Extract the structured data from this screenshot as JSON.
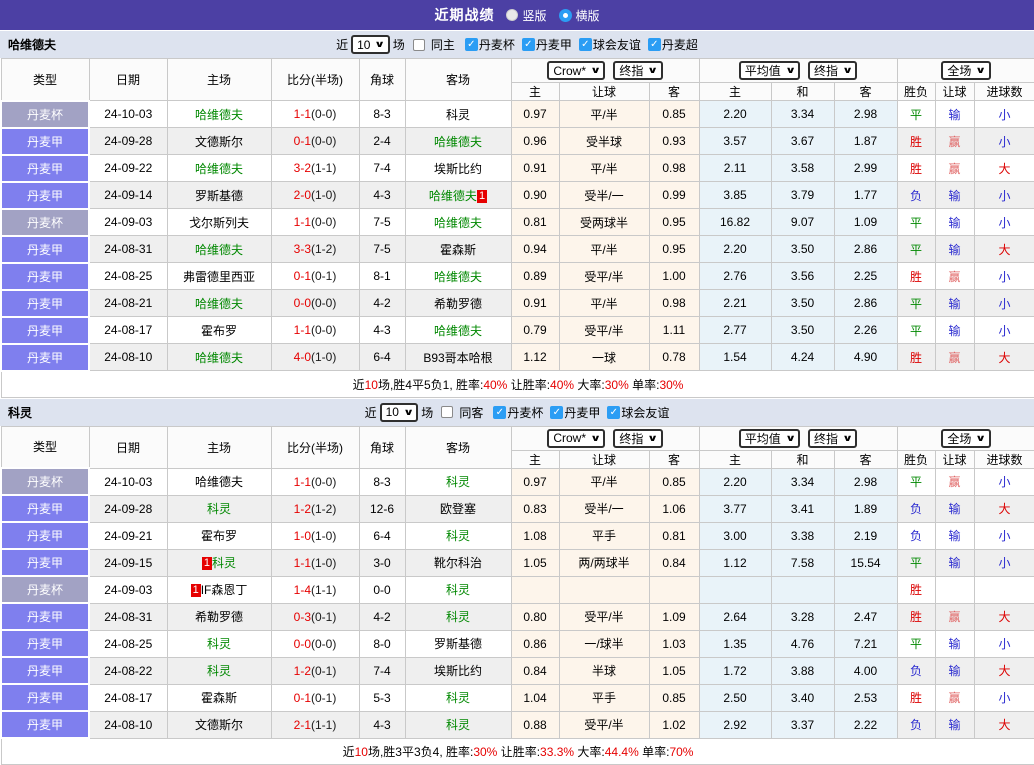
{
  "page": {
    "title": "近期战绩",
    "radios": [
      {
        "label": "竖版",
        "checked": false
      },
      {
        "label": "横版",
        "checked": true
      }
    ]
  },
  "table_header": {
    "static_cols": [
      "类型",
      "日期",
      "主场",
      "比分(半场)",
      "角球",
      "客场"
    ],
    "odds_selects": [
      "Crow*",
      "终指"
    ],
    "avg_selects": [
      "平均值",
      "终指"
    ],
    "scope_select": "全场",
    "odds_sub": [
      "主",
      "让球",
      "客"
    ],
    "avg_sub": [
      "主",
      "和",
      "客"
    ],
    "result_sub": [
      "胜负",
      "让球",
      "进球数"
    ]
  },
  "colors": {
    "topbar": "#4c40a4",
    "section_bar": "#dde3ef",
    "league_cup": "#a2a2c4",
    "league_league": "#7f7fee",
    "team_green": "#008800",
    "score_red": "#e60000",
    "win_red": "#dc0000",
    "draw_green": "#008800",
    "lose_blue": "#2a2ad0",
    "checkbox_blue": "#2b9df4"
  },
  "sections": [
    {
      "team": "哈维德夫",
      "filter": {
        "near": "近",
        "count": "10",
        "games": "场",
        "same": {
          "label": "同主",
          "checked": false
        },
        "leagues": [
          {
            "label": "丹麦杯",
            "checked": true
          },
          {
            "label": "丹麦甲",
            "checked": true
          },
          {
            "label": "球会友谊",
            "checked": true
          },
          {
            "label": "丹麦超",
            "checked": true
          }
        ]
      },
      "rows": [
        {
          "league": "丹麦杯",
          "league_type": "cup",
          "date": "24-10-03",
          "home": {
            "name": "哈维德夫",
            "green": true
          },
          "score": "1-1",
          "half": "(0-0)",
          "corner": "8-3",
          "away": {
            "name": "科灵",
            "green": false
          },
          "odds": [
            "0.97",
            "平/半",
            "0.85"
          ],
          "avg": [
            "2.20",
            "3.34",
            "2.98"
          ],
          "result": {
            "text": "平",
            "c": "green"
          },
          "let_result": {
            "text": "输",
            "c": "blue"
          },
          "goal_result": {
            "text": "小",
            "c": "blue"
          }
        },
        {
          "league": "丹麦甲",
          "league_type": "lg",
          "date": "24-09-28",
          "home": {
            "name": "文德斯尔",
            "green": false
          },
          "score": "0-1",
          "half": "(0-0)",
          "corner": "2-4",
          "away": {
            "name": "哈维德夫",
            "green": true
          },
          "odds": [
            "0.96",
            "受半球",
            "0.93"
          ],
          "avg": [
            "3.57",
            "3.67",
            "1.87"
          ],
          "result": {
            "text": "胜",
            "c": "red"
          },
          "let_result": {
            "text": "赢",
            "c": "softred"
          },
          "goal_result": {
            "text": "小",
            "c": "blue"
          }
        },
        {
          "league": "丹麦甲",
          "league_type": "lg",
          "date": "24-09-22",
          "home": {
            "name": "哈维德夫",
            "green": true
          },
          "score": "3-2",
          "half": "(1-1)",
          "corner": "7-4",
          "away": {
            "name": "埃斯比约",
            "green": false
          },
          "odds": [
            "0.91",
            "平/半",
            "0.98"
          ],
          "avg": [
            "2.11",
            "3.58",
            "2.99"
          ],
          "result": {
            "text": "胜",
            "c": "red"
          },
          "let_result": {
            "text": "赢",
            "c": "softred"
          },
          "goal_result": {
            "text": "大",
            "c": "red"
          }
        },
        {
          "league": "丹麦甲",
          "league_type": "lg",
          "date": "24-09-14",
          "home": {
            "name": "罗斯基德",
            "green": false
          },
          "score": "2-0",
          "half": "(1-0)",
          "corner": "4-3",
          "away": {
            "name": "哈维德夫",
            "green": true,
            "badge": "1",
            "badge_pos": "after"
          },
          "odds": [
            "0.90",
            "受半/一",
            "0.99"
          ],
          "avg": [
            "3.85",
            "3.79",
            "1.77"
          ],
          "result": {
            "text": "负",
            "c": "blue"
          },
          "let_result": {
            "text": "输",
            "c": "blue"
          },
          "goal_result": {
            "text": "小",
            "c": "blue"
          }
        },
        {
          "league": "丹麦杯",
          "league_type": "cup",
          "date": "24-09-03",
          "home": {
            "name": "戈尔斯列夫",
            "green": false
          },
          "score": "1-1",
          "half": "(0-0)",
          "corner": "7-5",
          "away": {
            "name": "哈维德夫",
            "green": true
          },
          "odds": [
            "0.81",
            "受两球半",
            "0.95"
          ],
          "avg": [
            "16.82",
            "9.07",
            "1.09"
          ],
          "result": {
            "text": "平",
            "c": "green"
          },
          "let_result": {
            "text": "输",
            "c": "blue"
          },
          "goal_result": {
            "text": "小",
            "c": "blue"
          }
        },
        {
          "league": "丹麦甲",
          "league_type": "lg",
          "date": "24-08-31",
          "home": {
            "name": "哈维德夫",
            "green": true
          },
          "score": "3-3",
          "half": "(1-2)",
          "corner": "7-5",
          "away": {
            "name": "霍森斯",
            "green": false
          },
          "odds": [
            "0.94",
            "平/半",
            "0.95"
          ],
          "avg": [
            "2.20",
            "3.50",
            "2.86"
          ],
          "result": {
            "text": "平",
            "c": "green"
          },
          "let_result": {
            "text": "输",
            "c": "blue"
          },
          "goal_result": {
            "text": "大",
            "c": "red"
          }
        },
        {
          "league": "丹麦甲",
          "league_type": "lg",
          "date": "24-08-25",
          "home": {
            "name": "弗雷德里西亚",
            "green": false
          },
          "score": "0-1",
          "half": "(0-1)",
          "corner": "8-1",
          "away": {
            "name": "哈维德夫",
            "green": true
          },
          "odds": [
            "0.89",
            "受平/半",
            "1.00"
          ],
          "avg": [
            "2.76",
            "3.56",
            "2.25"
          ],
          "result": {
            "text": "胜",
            "c": "red"
          },
          "let_result": {
            "text": "赢",
            "c": "softred"
          },
          "goal_result": {
            "text": "小",
            "c": "blue"
          }
        },
        {
          "league": "丹麦甲",
          "league_type": "lg",
          "date": "24-08-21",
          "home": {
            "name": "哈维德夫",
            "green": true
          },
          "score": "0-0",
          "half": "(0-0)",
          "corner": "4-2",
          "away": {
            "name": "希勒罗德",
            "green": false
          },
          "odds": [
            "0.91",
            "平/半",
            "0.98"
          ],
          "avg": [
            "2.21",
            "3.50",
            "2.86"
          ],
          "result": {
            "text": "平",
            "c": "green"
          },
          "let_result": {
            "text": "输",
            "c": "blue"
          },
          "goal_result": {
            "text": "小",
            "c": "blue"
          }
        },
        {
          "league": "丹麦甲",
          "league_type": "lg",
          "date": "24-08-17",
          "home": {
            "name": "霍布罗",
            "green": false
          },
          "score": "1-1",
          "half": "(0-0)",
          "corner": "4-3",
          "away": {
            "name": "哈维德夫",
            "green": true
          },
          "odds": [
            "0.79",
            "受平/半",
            "1.11"
          ],
          "avg": [
            "2.77",
            "3.50",
            "2.26"
          ],
          "result": {
            "text": "平",
            "c": "green"
          },
          "let_result": {
            "text": "输",
            "c": "blue"
          },
          "goal_result": {
            "text": "小",
            "c": "blue"
          }
        },
        {
          "league": "丹麦甲",
          "league_type": "lg",
          "date": "24-08-10",
          "home": {
            "name": "哈维德夫",
            "green": true
          },
          "score": "4-0",
          "half": "(1-0)",
          "corner": "6-4",
          "away": {
            "name": "B93哥本哈根",
            "green": false
          },
          "odds": [
            "1.12",
            "一球",
            "0.78"
          ],
          "avg": [
            "1.54",
            "4.24",
            "4.90"
          ],
          "result": {
            "text": "胜",
            "c": "red"
          },
          "let_result": {
            "text": "赢",
            "c": "softred"
          },
          "goal_result": {
            "text": "大",
            "c": "red"
          }
        }
      ],
      "summary": [
        {
          "text": "近"
        },
        {
          "text": "10",
          "red": true
        },
        {
          "text": "场,胜4平5负1, 胜率:"
        },
        {
          "text": "40%",
          "red": true
        },
        {
          "text": " 让胜率:"
        },
        {
          "text": "40%",
          "red": true
        },
        {
          "text": " 大率:"
        },
        {
          "text": "30%",
          "red": true
        },
        {
          "text": " 单率:"
        },
        {
          "text": "30%",
          "red": true
        }
      ]
    },
    {
      "team": "科灵",
      "filter": {
        "near": "近",
        "count": "10",
        "games": "场",
        "same": {
          "label": "同客",
          "checked": false
        },
        "leagues": [
          {
            "label": "丹麦杯",
            "checked": true
          },
          {
            "label": "丹麦甲",
            "checked": true
          },
          {
            "label": "球会友谊",
            "checked": true
          }
        ]
      },
      "rows": [
        {
          "league": "丹麦杯",
          "league_type": "cup",
          "date": "24-10-03",
          "home": {
            "name": "哈维德夫",
            "green": false
          },
          "score": "1-1",
          "half": "(0-0)",
          "corner": "8-3",
          "away": {
            "name": "科灵",
            "green": true
          },
          "odds": [
            "0.97",
            "平/半",
            "0.85"
          ],
          "avg": [
            "2.20",
            "3.34",
            "2.98"
          ],
          "result": {
            "text": "平",
            "c": "green"
          },
          "let_result": {
            "text": "赢",
            "c": "softred"
          },
          "goal_result": {
            "text": "小",
            "c": "blue"
          }
        },
        {
          "league": "丹麦甲",
          "league_type": "lg",
          "date": "24-09-28",
          "home": {
            "name": "科灵",
            "green": true
          },
          "score": "1-2",
          "half": "(1-2)",
          "corner": "12-6",
          "away": {
            "name": "欧登塞",
            "green": false
          },
          "odds": [
            "0.83",
            "受半/一",
            "1.06"
          ],
          "avg": [
            "3.77",
            "3.41",
            "1.89"
          ],
          "result": {
            "text": "负",
            "c": "blue"
          },
          "let_result": {
            "text": "输",
            "c": "blue"
          },
          "goal_result": {
            "text": "大",
            "c": "red"
          }
        },
        {
          "league": "丹麦甲",
          "league_type": "lg",
          "date": "24-09-21",
          "home": {
            "name": "霍布罗",
            "green": false
          },
          "score": "1-0",
          "half": "(1-0)",
          "corner": "6-4",
          "away": {
            "name": "科灵",
            "green": true
          },
          "odds": [
            "1.08",
            "平手",
            "0.81"
          ],
          "avg": [
            "3.00",
            "3.38",
            "2.19"
          ],
          "result": {
            "text": "负",
            "c": "blue"
          },
          "let_result": {
            "text": "输",
            "c": "blue"
          },
          "goal_result": {
            "text": "小",
            "c": "blue"
          }
        },
        {
          "league": "丹麦甲",
          "league_type": "lg",
          "date": "24-09-15",
          "home": {
            "name": "科灵",
            "green": true,
            "badge": "1",
            "badge_pos": "before"
          },
          "score": "1-1",
          "half": "(1-0)",
          "corner": "3-0",
          "away": {
            "name": "靴尔科治",
            "green": false
          },
          "odds": [
            "1.05",
            "两/两球半",
            "0.84"
          ],
          "avg": [
            "1.12",
            "7.58",
            "15.54"
          ],
          "result": {
            "text": "平",
            "c": "green"
          },
          "let_result": {
            "text": "输",
            "c": "blue"
          },
          "goal_result": {
            "text": "小",
            "c": "blue"
          }
        },
        {
          "league": "丹麦杯",
          "league_type": "cup",
          "date": "24-09-03",
          "home": {
            "name": "IF森恩丁",
            "green": false,
            "badge": "1",
            "badge_pos": "before"
          },
          "score": "1-4",
          "half": "(1-1)",
          "corner": "0-0",
          "away": {
            "name": "科灵",
            "green": true
          },
          "odds": [
            "",
            "",
            ""
          ],
          "avg": [
            "",
            "",
            ""
          ],
          "result": {
            "text": "胜",
            "c": "red"
          },
          "let_result": {
            "text": "",
            "c": "blue"
          },
          "goal_result": {
            "text": "",
            "c": "blue"
          }
        },
        {
          "league": "丹麦甲",
          "league_type": "lg",
          "date": "24-08-31",
          "home": {
            "name": "希勒罗德",
            "green": false
          },
          "score": "0-3",
          "half": "(0-1)",
          "corner": "4-2",
          "away": {
            "name": "科灵",
            "green": true
          },
          "odds": [
            "0.80",
            "受平/半",
            "1.09"
          ],
          "avg": [
            "2.64",
            "3.28",
            "2.47"
          ],
          "result": {
            "text": "胜",
            "c": "red"
          },
          "let_result": {
            "text": "赢",
            "c": "softred"
          },
          "goal_result": {
            "text": "大",
            "c": "red"
          }
        },
        {
          "league": "丹麦甲",
          "league_type": "lg",
          "date": "24-08-25",
          "home": {
            "name": "科灵",
            "green": true
          },
          "score": "0-0",
          "half": "(0-0)",
          "corner": "8-0",
          "away": {
            "name": "罗斯基德",
            "green": false
          },
          "odds": [
            "0.86",
            "一/球半",
            "1.03"
          ],
          "avg": [
            "1.35",
            "4.76",
            "7.21"
          ],
          "result": {
            "text": "平",
            "c": "green"
          },
          "let_result": {
            "text": "输",
            "c": "blue"
          },
          "goal_result": {
            "text": "小",
            "c": "blue"
          }
        },
        {
          "league": "丹麦甲",
          "league_type": "lg",
          "date": "24-08-22",
          "home": {
            "name": "科灵",
            "green": true
          },
          "score": "1-2",
          "half": "(0-1)",
          "corner": "7-4",
          "away": {
            "name": "埃斯比约",
            "green": false
          },
          "odds": [
            "0.84",
            "半球",
            "1.05"
          ],
          "avg": [
            "1.72",
            "3.88",
            "4.00"
          ],
          "result": {
            "text": "负",
            "c": "blue"
          },
          "let_result": {
            "text": "输",
            "c": "blue"
          },
          "goal_result": {
            "text": "大",
            "c": "red"
          }
        },
        {
          "league": "丹麦甲",
          "league_type": "lg",
          "date": "24-08-17",
          "home": {
            "name": "霍森斯",
            "green": false
          },
          "score": "0-1",
          "half": "(0-1)",
          "corner": "5-3",
          "away": {
            "name": "科灵",
            "green": true
          },
          "odds": [
            "1.04",
            "平手",
            "0.85"
          ],
          "avg": [
            "2.50",
            "3.40",
            "2.53"
          ],
          "result": {
            "text": "胜",
            "c": "red"
          },
          "let_result": {
            "text": "赢",
            "c": "softred"
          },
          "goal_result": {
            "text": "小",
            "c": "blue"
          }
        },
        {
          "league": "丹麦甲",
          "league_type": "lg",
          "date": "24-08-10",
          "home": {
            "name": "文德斯尔",
            "green": false
          },
          "score": "2-1",
          "half": "(1-1)",
          "corner": "4-3",
          "away": {
            "name": "科灵",
            "green": true
          },
          "odds": [
            "0.88",
            "受平/半",
            "1.02"
          ],
          "avg": [
            "2.92",
            "3.37",
            "2.22"
          ],
          "result": {
            "text": "负",
            "c": "blue"
          },
          "let_result": {
            "text": "输",
            "c": "blue"
          },
          "goal_result": {
            "text": "大",
            "c": "red"
          }
        }
      ],
      "summary": [
        {
          "text": "近"
        },
        {
          "text": "10",
          "red": true
        },
        {
          "text": "场,胜3平3负4, 胜率:"
        },
        {
          "text": "30%",
          "red": true
        },
        {
          "text": " 让胜率:"
        },
        {
          "text": "33.3%",
          "red": true
        },
        {
          "text": " 大率:"
        },
        {
          "text": "44.4%",
          "red": true
        },
        {
          "text": " 单率:"
        },
        {
          "text": "70%",
          "red": true
        }
      ]
    }
  ]
}
